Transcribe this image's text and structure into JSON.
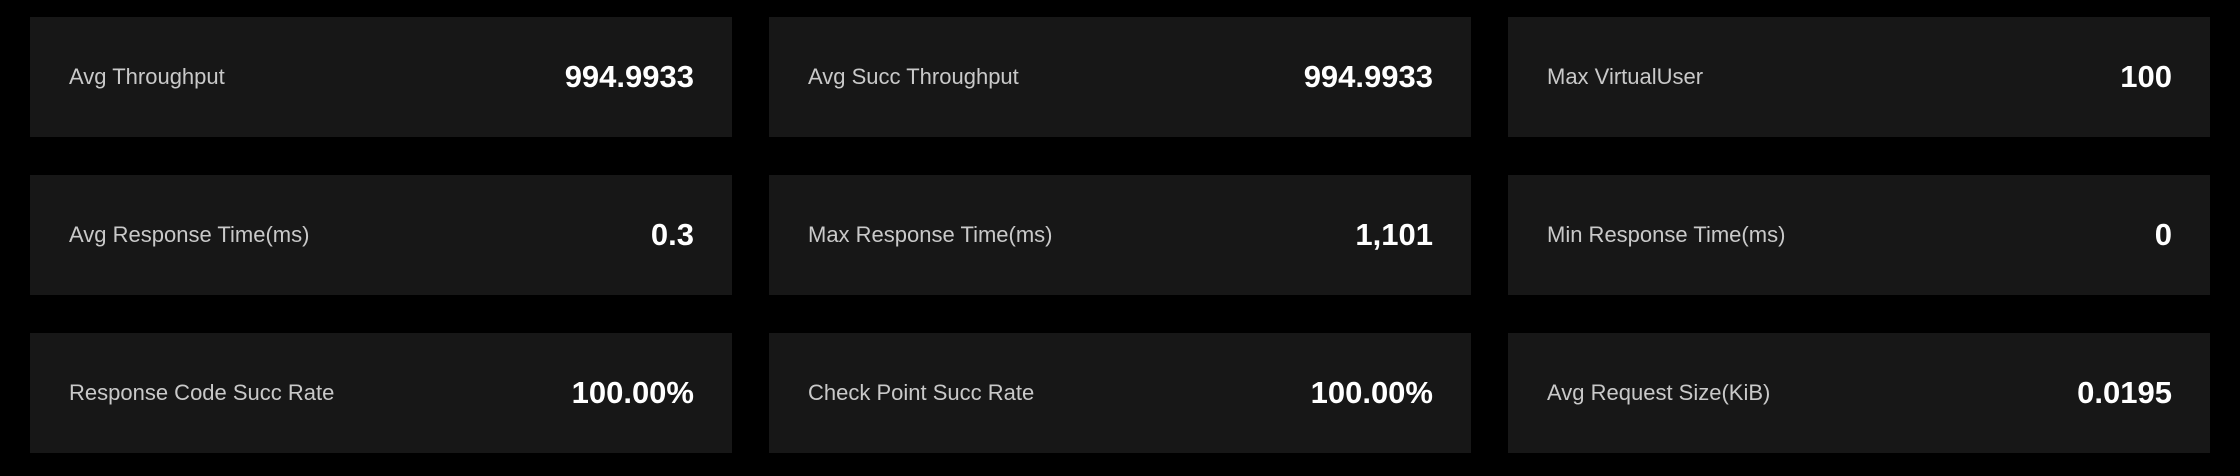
{
  "metrics": [
    {
      "label": "Avg Throughput",
      "value": "994.9933"
    },
    {
      "label": "Avg Succ Throughput",
      "value": "994.9933"
    },
    {
      "label": "Max VirtualUser",
      "value": "100"
    },
    {
      "label": "Avg Response Time(ms)",
      "value": "0.3"
    },
    {
      "label": "Max Response Time(ms)",
      "value": "1,101"
    },
    {
      "label": "Min Response Time(ms)",
      "value": "0"
    },
    {
      "label": "Response Code Succ Rate",
      "value": "100.00%"
    },
    {
      "label": "Check Point Succ Rate",
      "value": "100.00%"
    },
    {
      "label": "Avg Request Size(KiB)",
      "value": "0.0195"
    }
  ],
  "colors": {
    "background": "#000000",
    "card": "#171717",
    "label": "#c9c9c9",
    "value": "#ffffff"
  }
}
